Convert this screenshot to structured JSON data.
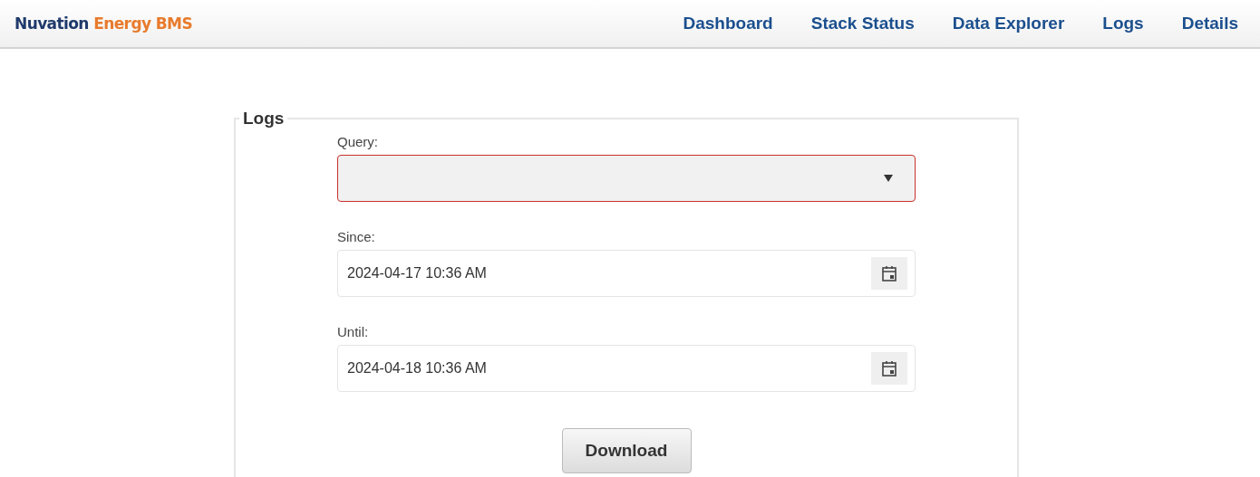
{
  "brand": {
    "primary": "Nuvation",
    "secondary": "Energy BMS"
  },
  "nav": [
    "Dashboard",
    "Stack Status",
    "Data Explorer",
    "Logs",
    "Details"
  ],
  "panel": {
    "legend": "Logs",
    "fields": [
      {
        "kind": "select",
        "label": "Query:",
        "invalid": true
      },
      {
        "kind": "date",
        "label": "Since:",
        "value": "2024-04-17 10:36 AM",
        "invalid": false
      },
      {
        "kind": "date",
        "label": "Until:",
        "value": "2024-04-18 10:36 AM",
        "invalid": false
      }
    ],
    "button": "Download"
  }
}
